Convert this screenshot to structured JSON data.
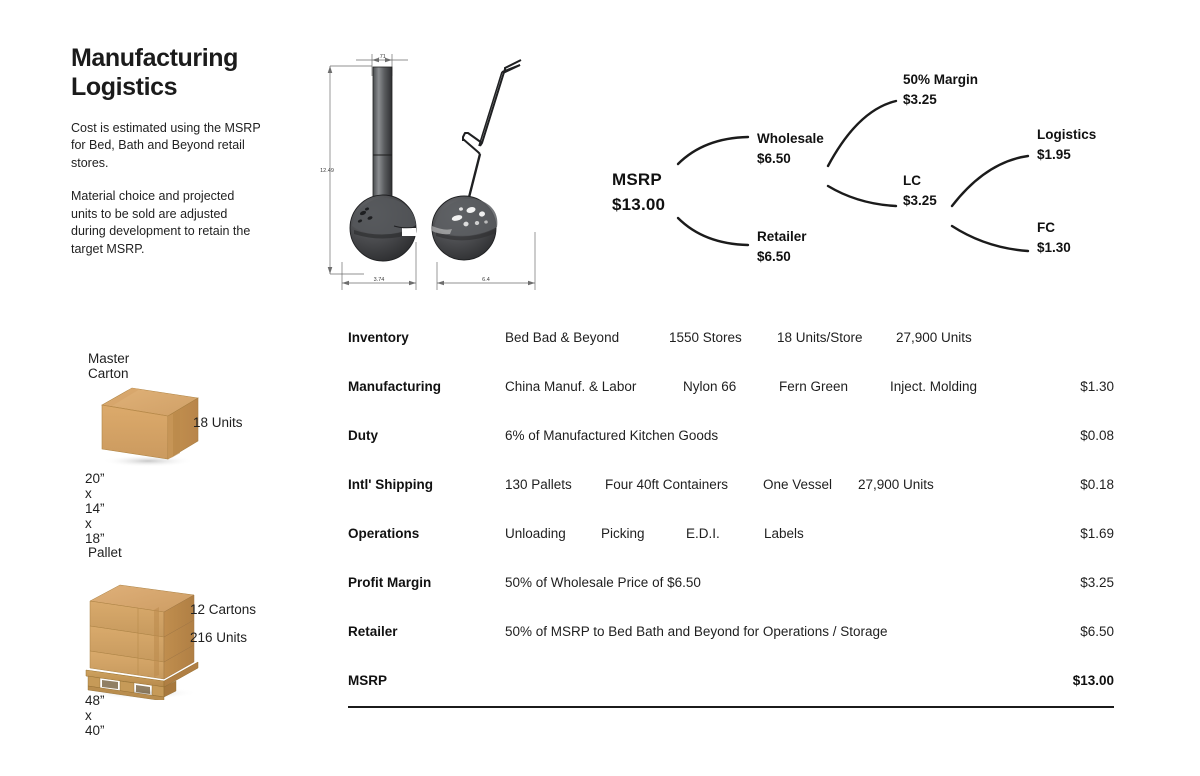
{
  "intro": {
    "title_line1": "Manufacturing",
    "title_line2": "Logistics",
    "paragraph1": "Cost is estimated using the MSRP for Bed, Bath and Beyond retail stores.",
    "paragraph2": "Material choice and projected units to be sold are adjusted during development to retain the target MSRP."
  },
  "technical_drawing": {
    "dim_handle_width": ".71",
    "dim_height": "12.49",
    "dim_front_width": "3.74",
    "dim_side_width": "6.4"
  },
  "price_tree": {
    "msrp": {
      "label": "MSRP",
      "value": "$13.00"
    },
    "wholesale": {
      "label": "Wholesale",
      "value": "$6.50"
    },
    "retailer": {
      "label": "Retailer",
      "value": "$6.50"
    },
    "margin": {
      "label": "50% Margin",
      "value": "$3.25"
    },
    "lc": {
      "label": "LC",
      "value": "$3.25"
    },
    "logistics": {
      "label": "Logistics",
      "value": "$1.95"
    },
    "fc": {
      "label": "FC",
      "value": "$1.30"
    }
  },
  "packaging": {
    "carton": {
      "title": "Master Carton",
      "units": "18 Units",
      "dimensions": "20” x 14” x 18”"
    },
    "pallet": {
      "title": "Pallet",
      "cartons": "12 Cartons",
      "units": "216 Units",
      "dimensions": "48” x 40”"
    }
  },
  "cost_table": {
    "rows": [
      {
        "label": "Inventory",
        "cells": [
          "Bed Bad & Beyond",
          "1550 Stores",
          "18 Units/Store",
          "27,900 Units"
        ],
        "price": ""
      },
      {
        "label": "Manufacturing",
        "cells": [
          "China Manuf. & Labor",
          "Nylon 66",
          "Fern Green",
          "Inject. Molding"
        ],
        "price": "$1.30"
      },
      {
        "label": "Duty",
        "cells": [
          "6% of Manufactured Kitchen Goods"
        ],
        "price": "$0.08"
      },
      {
        "label": "Intl' Shipping",
        "cells": [
          "130 Pallets",
          "Four 40ft Containers",
          "One Vessel",
          "27,900 Units"
        ],
        "price": "$0.18"
      },
      {
        "label": "Operations",
        "cells": [
          "Unloading",
          "Picking",
          "E.D.I.",
          "Labels"
        ],
        "price": "$1.69"
      },
      {
        "label": "Profit Margin",
        "cells": [
          "50% of Wholesale Price of $6.50"
        ],
        "price": "$3.25"
      },
      {
        "label": "Retailer",
        "cells": [
          "50% of MSRP to Bed Bath and Beyond for Operations / Storage"
        ],
        "price": "$6.50"
      },
      {
        "label": "MSRP",
        "cells": [],
        "price": "$13.00"
      }
    ]
  },
  "colors": {
    "ink": "#1b1b1b",
    "cardboard_top": "#d9a867",
    "cardboard_front": "#d3a066",
    "cardboard_side": "#bd8c4e",
    "ladle_dark": "#3a3a3c",
    "ladle_mid": "#585a5c",
    "pallet_wood": "#c9a05c"
  }
}
